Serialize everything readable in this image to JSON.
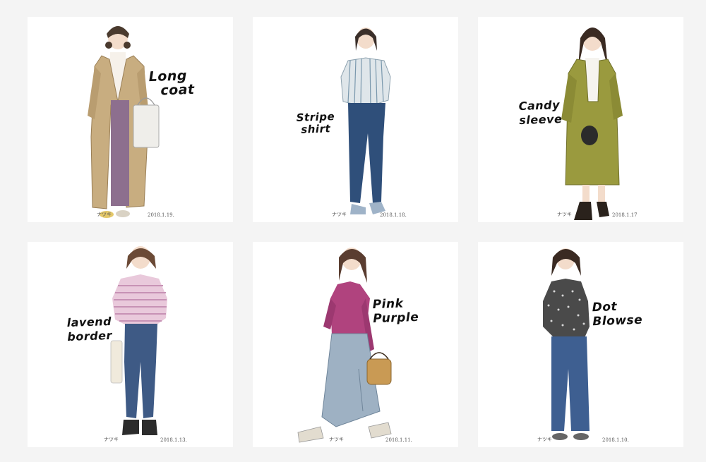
{
  "tiles": [
    {
      "caption_line1": "Long",
      "caption_line2": "coat",
      "signature": "ナツキ",
      "date": "2018.1.19."
    },
    {
      "caption_line1": "Stripe",
      "caption_line2": "shirt",
      "signature": "ナツキ",
      "date": "2018.1.18."
    },
    {
      "caption_line1": "Candy",
      "caption_line2": "sleeve",
      "signature": "ナツキ",
      "date": "2018.1.17"
    },
    {
      "caption_line1": "lavend",
      "caption_line2": "border",
      "signature": "ナツキ",
      "date": "2018.1.13."
    },
    {
      "caption_line1": "Pink",
      "caption_line2": "Purple",
      "signature": "ナツキ",
      "date": "2018.1.11."
    },
    {
      "caption_line1": "Dot",
      "caption_line2": "Blowse",
      "signature": "ナツキ",
      "date": "2018.1.10."
    }
  ]
}
